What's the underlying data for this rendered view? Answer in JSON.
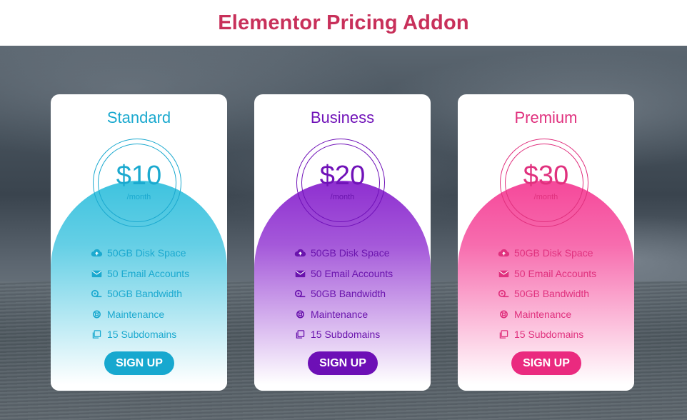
{
  "header": {
    "title": "Elementor Pricing Addon"
  },
  "plans": [
    {
      "name": "Standard",
      "price": "$10",
      "period": "/month",
      "features": [
        "50GB Disk Space",
        "50 Email Accounts",
        "50GB Bandwidth",
        "Maintenance",
        "15 Subdomains"
      ],
      "button": "SIGN UP",
      "colors": {
        "title": "#1ba9cf",
        "text": "#1ba9cf",
        "button": "#17a8cf",
        "gradient_top": "#3ec3df",
        "gradient_bottom": "#ffffff"
      }
    },
    {
      "name": "Business",
      "price": "$20",
      "period": "/month",
      "features": [
        "50GB Disk Space",
        "50 Email Accounts",
        "50GB Bandwidth",
        "Maintenance",
        "15 Subdomains"
      ],
      "button": "SIGN UP",
      "colors": {
        "title": "#7012b8",
        "text": "#6a14ad",
        "button": "#6d0fb6",
        "gradient_top": "#8e2fd0",
        "gradient_bottom": "#ffffff"
      }
    },
    {
      "name": "Premium",
      "price": "$30",
      "period": "/month",
      "features": [
        "50GB Disk Space",
        "50 Email Accounts",
        "50GB Bandwidth",
        "Maintenance",
        "15 Subdomains"
      ],
      "button": "SIGN UP",
      "colors": {
        "title": "#e0317e",
        "text": "#e0317e",
        "button": "#ea2a7f",
        "gradient_top": "#f5489a",
        "gradient_bottom": "#ffffff"
      }
    }
  ],
  "feature_icons": [
    "cloud-upload-icon",
    "envelope-icon",
    "hdd-icon",
    "lifebuoy-icon",
    "copy-icon"
  ]
}
